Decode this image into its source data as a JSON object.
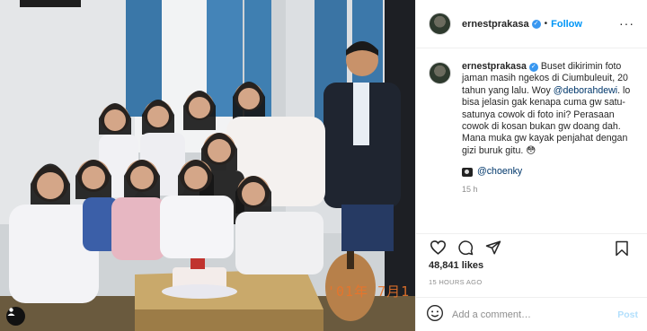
{
  "post": {
    "author": "ernestprakasa",
    "verified_icon": "verified-badge-icon",
    "follow_label": "Follow",
    "separator": "•",
    "more_icon": "more-options-icon",
    "caption_text": "Buset dikirimin foto jaman masih ngekos di Ciumbuleuit, 20 tahun yang lalu. Woy",
    "caption_mention": "@deborahdewi",
    "caption_rest": ". lo bisa jelasin gak kenapa cuma gw satu-satunya cowok di foto ini? Perasaan cowok di kosan bukan gw doang dah. Mana muka gw kayak penjahat dengan gizi buruk gitu. 😳",
    "credit_mention": "@choenky",
    "caption_time": "15 h",
    "likes": "48,841 likes",
    "timestamp": "15 HOURS AGO",
    "comment_placeholder": "Add a comment…",
    "post_label": "Post",
    "photo_date_stamp": "'01年 7月1",
    "accent_color": "#0095f6",
    "mention_color": "#00376b"
  },
  "icons": {
    "heart": "heart-icon",
    "comment": "comment-icon",
    "share": "share-icon",
    "save": "bookmark-icon",
    "emoji": "emoji-icon",
    "camera": "camera-icon",
    "tags": "user-tags-icon"
  }
}
